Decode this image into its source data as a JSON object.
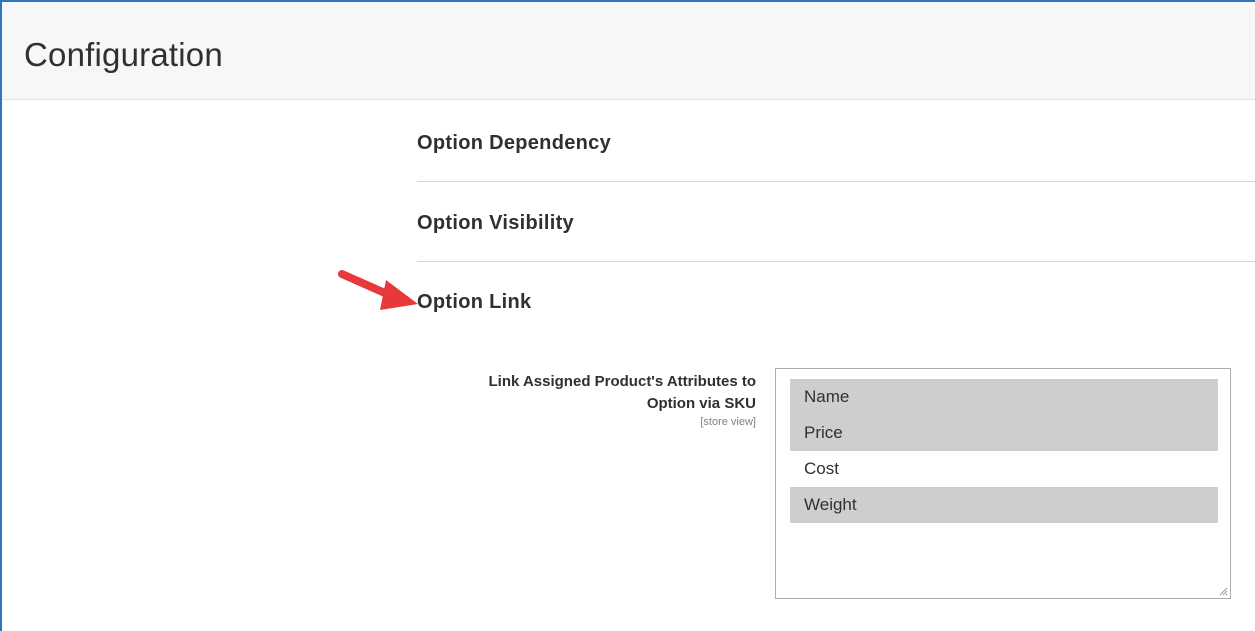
{
  "header": {
    "title": "Configuration"
  },
  "sections": {
    "dependency": "Option Dependency",
    "visibility": "Option Visibility",
    "link": "Option Link"
  },
  "field": {
    "label_line1": "Link Assigned Product's Attributes to",
    "label_line2": "Option via SKU",
    "scope": "[store view]"
  },
  "multiselect": {
    "options": [
      {
        "label": "Name",
        "selected": true
      },
      {
        "label": "Price",
        "selected": true
      },
      {
        "label": "Cost",
        "selected": false
      },
      {
        "label": "Weight",
        "selected": true
      }
    ]
  },
  "colors": {
    "frame_border": "#2b78c2",
    "header_bg": "#f7f7f7",
    "selected_bg": "#cecece",
    "arrow": "#e8393a"
  },
  "icons": {
    "annotation_arrow": "red-arrow-icon",
    "resize": "resize-grip-icon"
  }
}
